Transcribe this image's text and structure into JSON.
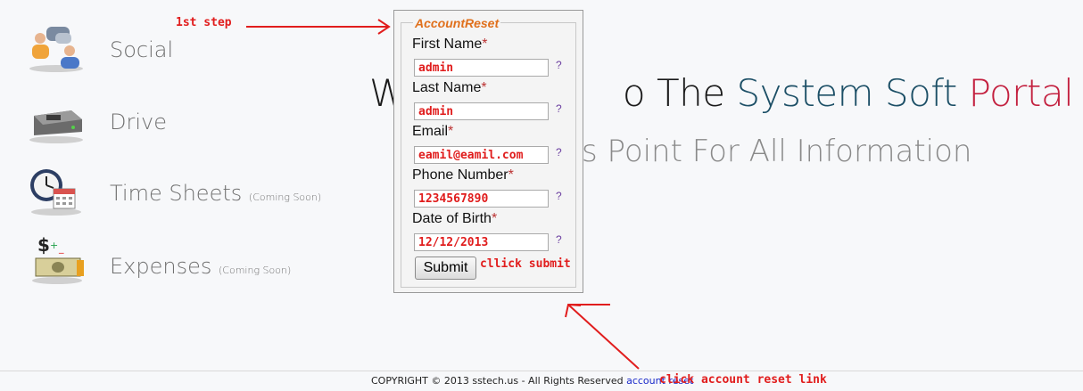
{
  "sidebar": {
    "items": [
      {
        "label": "Social",
        "note": "",
        "icon": "social-users-icon"
      },
      {
        "label": "Drive",
        "note": "",
        "icon": "drive-icon"
      },
      {
        "label": "Time Sheets",
        "note": "(Coming Soon)",
        "icon": "clock-calendar-icon"
      },
      {
        "label": "Expenses",
        "note": "(Coming Soon)",
        "icon": "money-icon"
      }
    ]
  },
  "hero": {
    "title_part1": "We",
    "title_part2": "o The ",
    "title_blue": "System Soft",
    "title_red": " Portal",
    "tagline": "s Point For All Information"
  },
  "form": {
    "legend": "AccountReset",
    "fields": [
      {
        "label": "First Name",
        "required": "*",
        "value": "admin",
        "help": "?"
      },
      {
        "label": "Last Name",
        "required": "*",
        "value": "admin",
        "help": "?"
      },
      {
        "label": "Email",
        "required": "*",
        "value": "eamil@eamil.com",
        "help": "?"
      },
      {
        "label": "Phone Number",
        "required": "*",
        "value": "1234567890",
        "help": "?"
      },
      {
        "label": "Date of Birth",
        "required": "*",
        "value": "12/12/2013",
        "help": "?"
      }
    ],
    "submit_label": "Submit"
  },
  "annotations": {
    "step1": "1st step",
    "submit": "cllick submit",
    "reset_link": "click account reset link"
  },
  "footer": {
    "copyright": "COPYRIGHT © 2013 sstech.us - All Rights Reserved",
    "link": "account reset"
  },
  "colors": {
    "title_blue": "#1c4f66",
    "title_red": "#c3203f",
    "legend_orange": "#e0701c",
    "annotation_red": "#e11d1d",
    "footer_link": "#1a29c9"
  }
}
